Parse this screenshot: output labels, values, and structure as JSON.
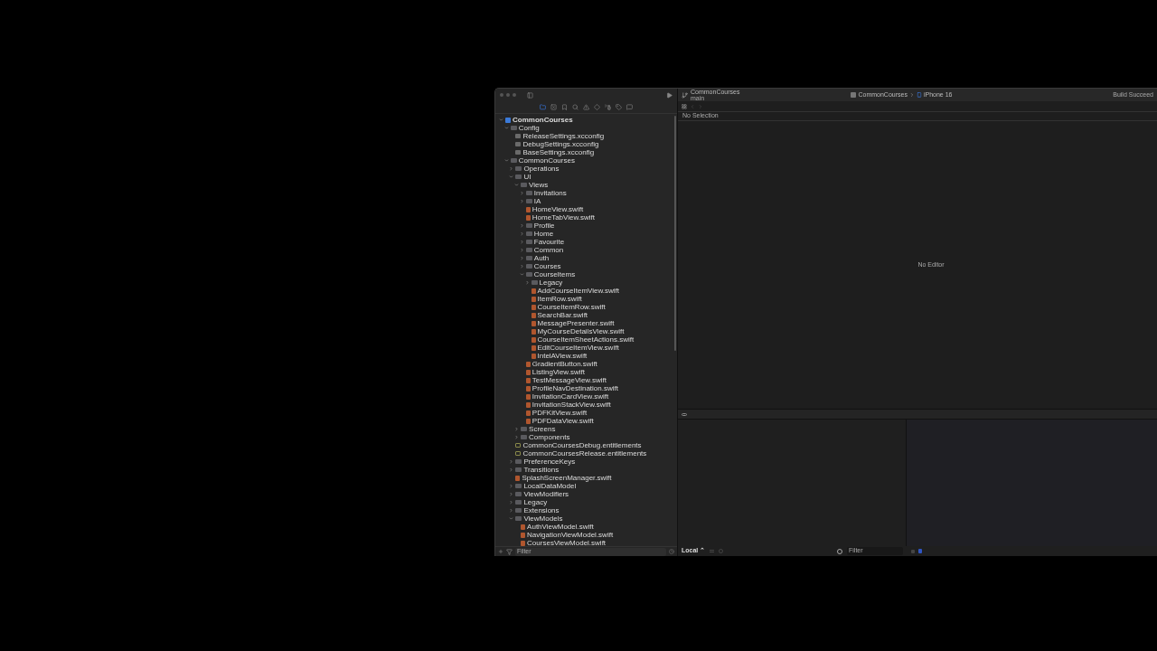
{
  "toolbar": {
    "project": "CommonCourses",
    "branch": "main",
    "scheme": "CommonCourses",
    "destination": "iPhone 16",
    "status": "Build Succeed"
  },
  "navigator": {
    "tabs": [
      {
        "selected": true
      },
      {
        "selected": false
      },
      {
        "selected": false
      },
      {
        "selected": false
      },
      {
        "selected": false
      },
      {
        "selected": false
      },
      {
        "selected": false
      },
      {
        "selected": false
      },
      {
        "selected": false
      }
    ],
    "tree": [
      {
        "name": "CommonCourses",
        "kind": "project",
        "expanded": true,
        "children": [
          {
            "name": "Config",
            "kind": "folder",
            "expanded": true,
            "children": [
              {
                "name": "ReleaseSettings.xcconfig",
                "kind": "config"
              },
              {
                "name": "DebugSettings.xcconfig",
                "kind": "config"
              },
              {
                "name": "BaseSettings.xcconfig",
                "kind": "config"
              }
            ]
          },
          {
            "name": "CommonCourses",
            "kind": "folder",
            "expanded": true,
            "children": [
              {
                "name": "Operations",
                "kind": "folder",
                "expanded": false
              },
              {
                "name": "UI",
                "kind": "folder",
                "expanded": true,
                "children": [
                  {
                    "name": "Views",
                    "kind": "folder",
                    "expanded": true,
                    "children": [
                      {
                        "name": "Invitations",
                        "kind": "folder",
                        "expanded": false
                      },
                      {
                        "name": "IA",
                        "kind": "folder",
                        "expanded": false
                      },
                      {
                        "name": "HomeView.swift",
                        "kind": "swift"
                      },
                      {
                        "name": "HomeTabView.swift",
                        "kind": "swift"
                      },
                      {
                        "name": "Profile",
                        "kind": "folder",
                        "expanded": false
                      },
                      {
                        "name": "Home",
                        "kind": "folder",
                        "expanded": false
                      },
                      {
                        "name": "Favourite",
                        "kind": "folder",
                        "expanded": false
                      },
                      {
                        "name": "Common",
                        "kind": "folder",
                        "expanded": false
                      },
                      {
                        "name": "Auth",
                        "kind": "folder",
                        "expanded": false
                      },
                      {
                        "name": "Courses",
                        "kind": "folder",
                        "expanded": false
                      },
                      {
                        "name": "CourseItems",
                        "kind": "folder",
                        "expanded": true,
                        "children": [
                          {
                            "name": "Legacy",
                            "kind": "folder",
                            "expanded": false
                          },
                          {
                            "name": "AddCourseItemView.swift",
                            "kind": "swift"
                          },
                          {
                            "name": "ItemRow.swift",
                            "kind": "swift"
                          },
                          {
                            "name": "CourseItemRow.swift",
                            "kind": "swift"
                          },
                          {
                            "name": "SearchBar.swift",
                            "kind": "swift"
                          },
                          {
                            "name": "MessagePresenter.swift",
                            "kind": "swift"
                          },
                          {
                            "name": "MyCourseDetailsView.swift",
                            "kind": "swift"
                          },
                          {
                            "name": "CourseItemSheetActions.swift",
                            "kind": "swift"
                          },
                          {
                            "name": "EditCourseItemView.swift",
                            "kind": "swift"
                          },
                          {
                            "name": "IntelAView.swift",
                            "kind": "swift"
                          }
                        ]
                      },
                      {
                        "name": "GradientButton.swift",
                        "kind": "swift"
                      },
                      {
                        "name": "ListingView.swift",
                        "kind": "swift"
                      },
                      {
                        "name": "TestMessageView.swift",
                        "kind": "swift"
                      },
                      {
                        "name": "ProfileNavDestination.swift",
                        "kind": "swift"
                      },
                      {
                        "name": "InvitationCardView.swift",
                        "kind": "swift"
                      },
                      {
                        "name": "InvitationStackView.swift",
                        "kind": "swift"
                      },
                      {
                        "name": "PDFKitView.swift",
                        "kind": "swift"
                      },
                      {
                        "name": "PDFDataView.swift",
                        "kind": "swift"
                      }
                    ]
                  },
                  {
                    "name": "Screens",
                    "kind": "folder",
                    "expanded": false
                  },
                  {
                    "name": "Components",
                    "kind": "folder",
                    "expanded": false
                  }
                ]
              },
              {
                "name": "CommonCoursesDebug.entitlements",
                "kind": "entitlements"
              },
              {
                "name": "CommonCoursesRelease.entitlements",
                "kind": "entitlements"
              },
              {
                "name": "PreferenceKeys",
                "kind": "folder",
                "expanded": false
              },
              {
                "name": "Transitions",
                "kind": "folder",
                "expanded": false
              },
              {
                "name": "SplashScreenManager.swift",
                "kind": "swift"
              },
              {
                "name": "LocalDataModel",
                "kind": "folder",
                "expanded": false
              },
              {
                "name": "ViewModifiers",
                "kind": "folder",
                "expanded": false
              },
              {
                "name": "Legacy",
                "kind": "folder",
                "expanded": false
              },
              {
                "name": "Extensions",
                "kind": "folder",
                "expanded": false
              },
              {
                "name": "ViewModels",
                "kind": "folder",
                "expanded": true,
                "children": [
                  {
                    "name": "AuthViewModel.swift",
                    "kind": "swift"
                  },
                  {
                    "name": "NavigationViewModel.swift",
                    "kind": "swift"
                  },
                  {
                    "name": "CoursesViewModel.swift",
                    "kind": "swift"
                  }
                ]
              }
            ]
          }
        ]
      }
    ],
    "filter": {
      "placeholder": "Filter"
    }
  },
  "editor": {
    "jump_bar": "No Selection",
    "message": "No Editor"
  },
  "debug": {
    "scope": "Local ⌃",
    "filter": {
      "placeholder": "Filter"
    }
  }
}
